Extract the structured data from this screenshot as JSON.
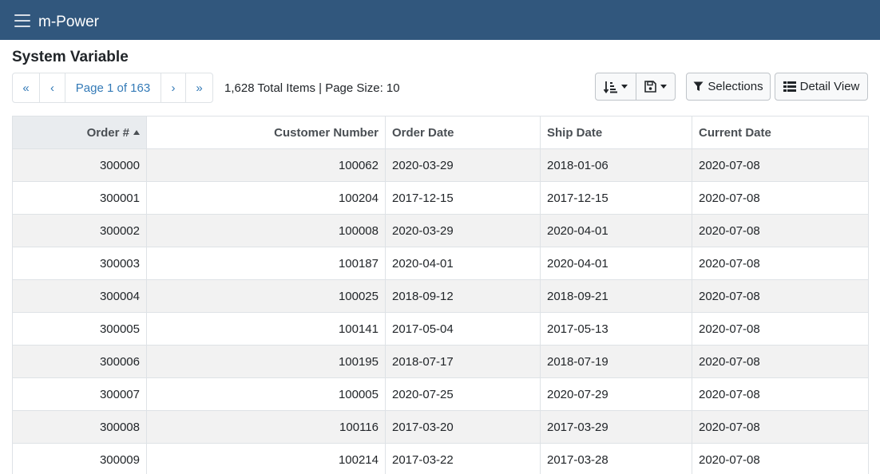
{
  "app": {
    "brand": "m-Power"
  },
  "page": {
    "title": "System Variable"
  },
  "pager": {
    "first_icon": "«",
    "prev_icon": "‹",
    "label": "Page 1 of 163",
    "next_icon": "›",
    "last_icon": "»",
    "summary": "1,628 Total Items | Page Size: 10"
  },
  "toolbar": {
    "sort_icon": "sort-amount-down-icon",
    "save_icon": "floppy-disk-icon",
    "selections_label": "Selections",
    "detail_view_label": "Detail View"
  },
  "table": {
    "columns": [
      "Order #",
      "Customer Number",
      "Order Date",
      "Ship Date",
      "Current Date"
    ],
    "sorted_column": "Order #",
    "sort_direction": "ascending",
    "rows": [
      [
        "300000",
        "100062",
        "2020-03-29",
        "2018-01-06",
        "2020-07-08"
      ],
      [
        "300001",
        "100204",
        "2017-12-15",
        "2017-12-15",
        "2020-07-08"
      ],
      [
        "300002",
        "100008",
        "2020-03-29",
        "2020-04-01",
        "2020-07-08"
      ],
      [
        "300003",
        "100187",
        "2020-04-01",
        "2020-04-01",
        "2020-07-08"
      ],
      [
        "300004",
        "100025",
        "2018-09-12",
        "2018-09-21",
        "2020-07-08"
      ],
      [
        "300005",
        "100141",
        "2017-05-04",
        "2017-05-13",
        "2020-07-08"
      ],
      [
        "300006",
        "100195",
        "2018-07-17",
        "2018-07-19",
        "2020-07-08"
      ],
      [
        "300007",
        "100005",
        "2020-07-25",
        "2020-07-29",
        "2020-07-08"
      ],
      [
        "300008",
        "100116",
        "2017-03-20",
        "2017-03-29",
        "2020-07-08"
      ],
      [
        "300009",
        "100214",
        "2017-03-22",
        "2017-03-28",
        "2020-07-08"
      ]
    ]
  },
  "colors": {
    "navbar": "#31577d",
    "link": "#337ab7",
    "stripe": "#f2f2f2"
  }
}
